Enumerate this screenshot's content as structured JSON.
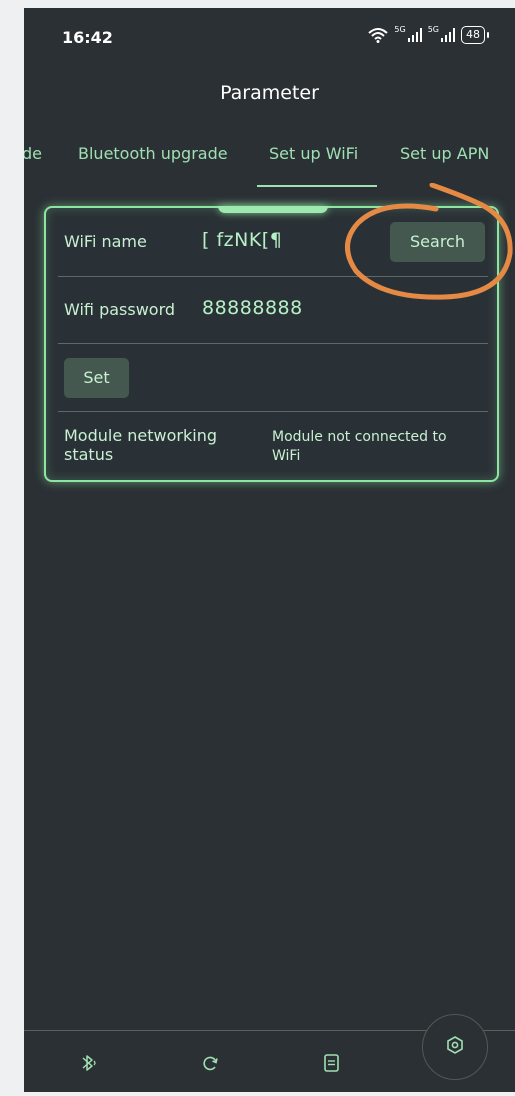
{
  "status_bar": {
    "time": "16:42",
    "signal1_label": "5G",
    "signal2_label": "5G",
    "battery": "48"
  },
  "header": {
    "title": "Parameter"
  },
  "tabs": [
    {
      "label": "de"
    },
    {
      "label": "Bluetooth upgrade"
    },
    {
      "label": "Set up WiFi",
      "active": true
    },
    {
      "label": "Set up APN"
    }
  ],
  "wifi_form": {
    "wifi_name_label": "WiFi name",
    "wifi_name_value": "[ fzNK[¶",
    "search_button": "Search",
    "wifi_password_label": "Wifi password",
    "wifi_password_value": "88888888",
    "set_button": "Set",
    "network_status_label": "Module networking status",
    "network_status_value": "Module not connected to WiFi"
  },
  "bottom_nav": {
    "items": [
      "bluetooth-icon",
      "refresh-icon",
      "document-icon",
      "settings-icon"
    ]
  },
  "colors": {
    "background": "#2b3035",
    "accent": "#8ee59f",
    "annotation": "#e58a45"
  }
}
